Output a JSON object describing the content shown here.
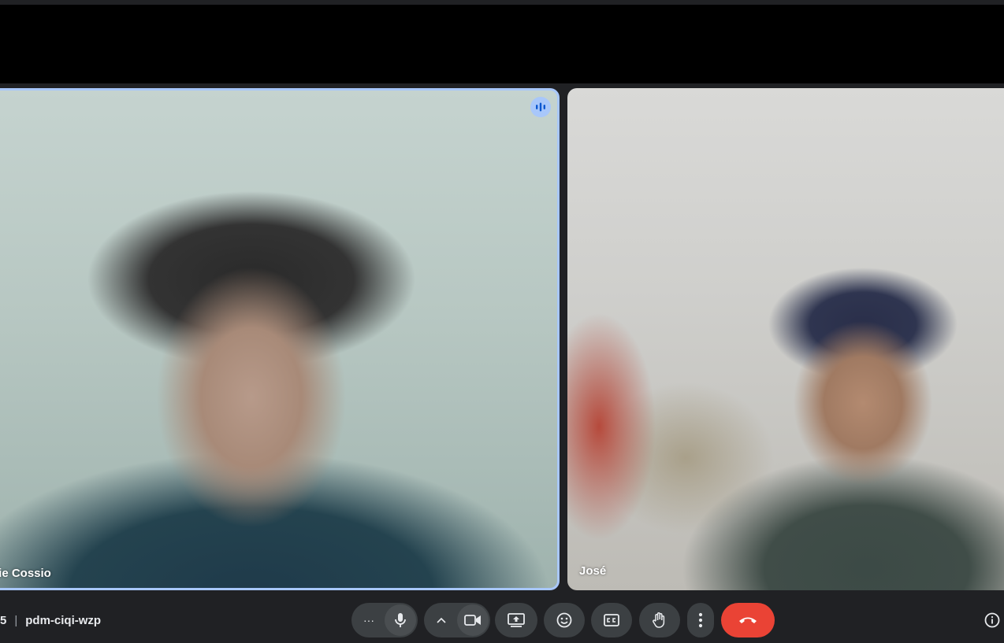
{
  "participants": [
    {
      "name": "nie Cossio",
      "speaking": true
    },
    {
      "name": "José",
      "speaking": false
    }
  ],
  "meeting": {
    "time_fragment": "5",
    "separator": "|",
    "code": "pdm-ciqi-wzp"
  },
  "controls": {
    "more_options_glyph": "···",
    "icons": [
      "dots-horizontal-icon",
      "microphone-icon",
      "chevron-up-icon",
      "camera-icon",
      "present-screen-icon",
      "emoji-icon",
      "captions-icon",
      "raise-hand-icon",
      "more-vert-icon",
      "end-call-icon",
      "info-icon"
    ]
  },
  "colors": {
    "speaking_accent": "#a8c7fa",
    "end_call": "#ea4335",
    "control_bg": "#3c4043",
    "bar_bg": "#202124"
  }
}
